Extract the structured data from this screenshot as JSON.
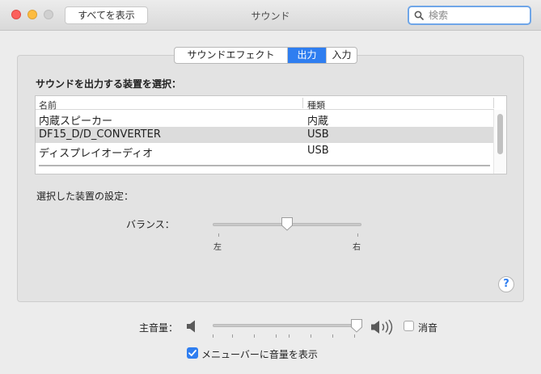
{
  "window": {
    "title": "サウンド",
    "show_all_label": "すべてを表示",
    "search_placeholder": "検索"
  },
  "tabs": [
    {
      "label": "サウンドエフェクト",
      "selected": false
    },
    {
      "label": "出力",
      "selected": true
    },
    {
      "label": "入力",
      "selected": false
    }
  ],
  "output": {
    "section_title": "サウンドを出力する装置を選択：",
    "columns": [
      "名前",
      "種類"
    ],
    "devices": [
      {
        "name": "内蔵スピーカー",
        "type": "内蔵"
      },
      {
        "name": "DF15_D/D_CONVERTER",
        "type": "USB",
        "selected": true
      },
      {
        "name": "ディスプレイオーディオ",
        "type": "USB"
      }
    ],
    "settings_label": "選択した装置の設定：",
    "balance": {
      "label": "バランス：",
      "left_label": "左",
      "right_label": "右",
      "value": 0.5
    }
  },
  "volume": {
    "label": "主音量：",
    "level": 0.97,
    "mute_label": "消音",
    "mute_checked": false,
    "menu_label": "メニューバーに音量を表示",
    "menu_checked": true
  },
  "colors": {
    "accent": "#2f7ef0",
    "close": "#fc605c",
    "minimize": "#fdbc40"
  }
}
